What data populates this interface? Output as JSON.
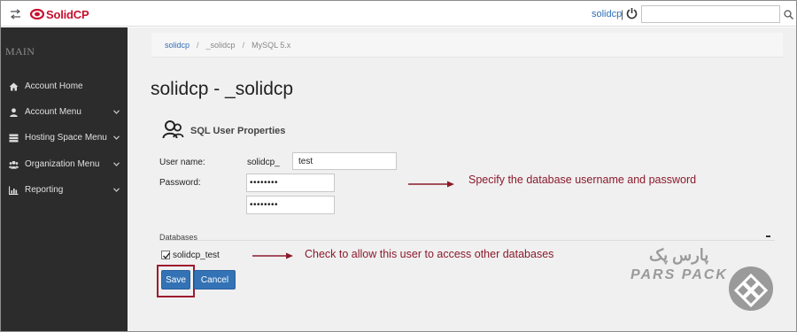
{
  "app": {
    "brand": "SolidCP",
    "brand_color": "#c8102e",
    "accent": "#3372b5"
  },
  "topbar": {
    "menu_toggle_icon": "arrows-swap-icon",
    "user": "solidcp",
    "separator": "|",
    "power_icon": "power-icon",
    "search_placeholder": "",
    "search_icon": "search-icon"
  },
  "sidebar": {
    "heading": "MAIN",
    "items": [
      {
        "label": "Account Home",
        "icon": "home-icon",
        "has_submenu": false
      },
      {
        "label": "Account Menu",
        "icon": "user-icon",
        "has_submenu": true
      },
      {
        "label": "Hosting Space Menu",
        "icon": "server-icon",
        "has_submenu": true
      },
      {
        "label": "Organization Menu",
        "icon": "users-icon",
        "has_submenu": true
      },
      {
        "label": "Reporting",
        "icon": "chart-icon",
        "has_submenu": true
      }
    ]
  },
  "breadcrumb": {
    "items": [
      "solidcp",
      "_solidcp",
      "MySQL 5.x"
    ],
    "separator": "/"
  },
  "page": {
    "title": "solidcp - _solidcp",
    "panel_title": "SQL User Properties",
    "username_label": "User name:",
    "username_prefix": "solidcp_",
    "username_value": "test",
    "password_label": "Password:",
    "password_value": "••••••••",
    "password_confirm_value": "••••••••",
    "databases_heading": "Databases",
    "database_item": "solidcp_test",
    "database_checked": true,
    "save_label": "Save",
    "cancel_label": "Cancel"
  },
  "annotations": {
    "arrow_color": "#8b1a2b",
    "note_credentials": "Specify the database username and password",
    "note_databases": "Check to allow this user to access other databases"
  },
  "watermark": {
    "text_latin": "PARS PACK",
    "text_fa": "پارس پک"
  }
}
